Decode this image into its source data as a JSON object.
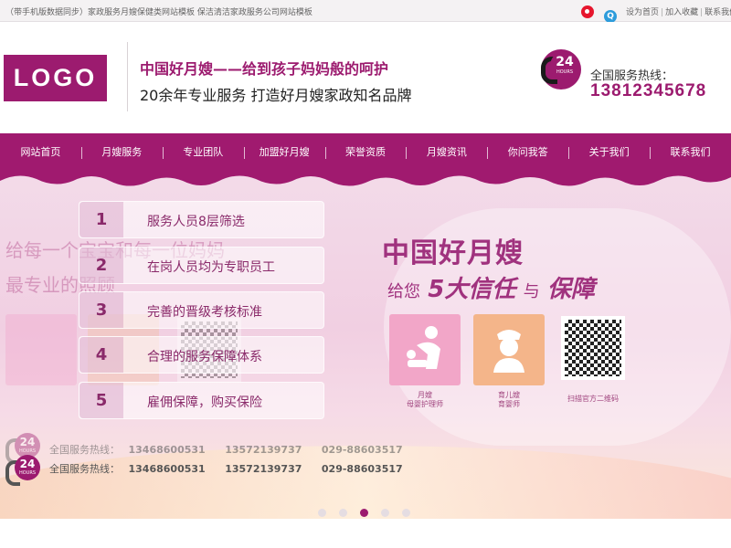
{
  "topbar": {
    "text": "（带手机版数据同步）家政服务月嫂保健类网站模板 保洁清洁家政服务公司网站模板",
    "icons": [
      "weibo-icon",
      "qq-icon"
    ],
    "links": [
      "设为首页",
      "加入收藏",
      "联系我们"
    ]
  },
  "header": {
    "logo": "LOGO",
    "slogan_title": "中国好月嫂——给到孩子妈妈般的呵护",
    "slogan_sub": "20余年专业服务 打造好月嫂家政知名品牌",
    "badge_number": "24",
    "badge_text": "HOURS",
    "hotline_label": "全国服务热线：",
    "hotline_number": "13812345678"
  },
  "nav": {
    "items": [
      "网站首页",
      "月嫂服务",
      "专业团队",
      "加盟好月嫂",
      "荣誉资质",
      "月嫂资讯",
      "你问我答",
      "关于我们",
      "联系我们"
    ]
  },
  "banner": {
    "ghost_line1": "给每一个宝宝和每一位妈妈",
    "ghost_line2": "最专业的照顾",
    "features": [
      {
        "num": "1",
        "label": "服务人员8层筛选"
      },
      {
        "num": "2",
        "label": "在岗人员均为专职员工"
      },
      {
        "num": "3",
        "label": "完善的晋级考核标准"
      },
      {
        "num": "4",
        "label": "合理的服务保障体系"
      },
      {
        "num": "5",
        "label": "雇佣保障，购买保险"
      }
    ],
    "title": "中国好月嫂",
    "sub_pre": "给您",
    "sub_strong": "5大信任",
    "sub_conj": "与",
    "sub_end": "保障",
    "tiles": [
      {
        "line1": "月嫂",
        "line2": "母婴护理师",
        "icon": "mother-baby-icon"
      },
      {
        "line1": "育儿嫂",
        "line2": "育婴师",
        "icon": "nurse-icon"
      },
      {
        "line1": "扫描官方二维码",
        "line2": "",
        "icon": "qr-code"
      }
    ],
    "hotline_label": "全国服务热线：",
    "hotline_numbers": [
      "13468600531",
      "13572139737",
      "029-88603517"
    ],
    "badge_number": "24",
    "badge_text": "HOURS",
    "slides": 5,
    "active_slide": 3
  },
  "colors": {
    "brand": "#9c1b6f",
    "nav_bg": "#a01a6f",
    "banner_text": "#a0327e"
  }
}
